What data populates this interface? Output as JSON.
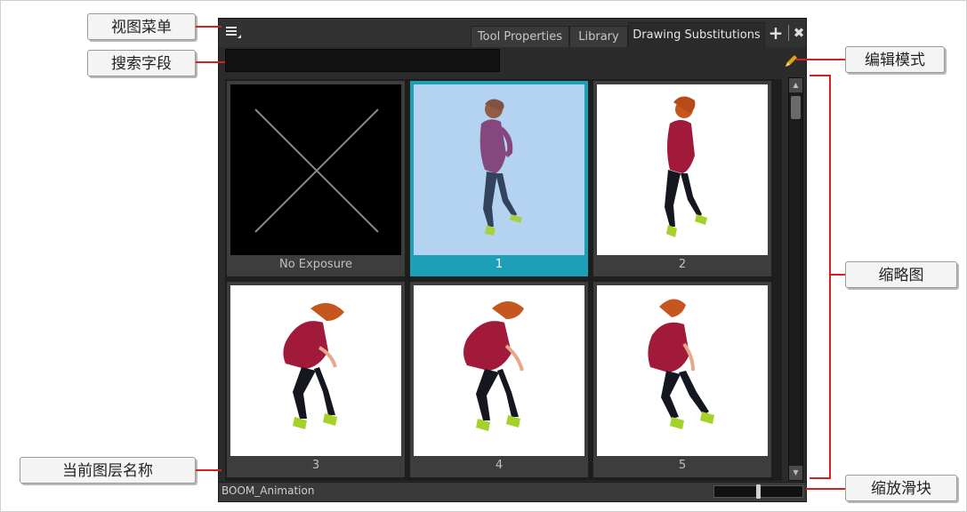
{
  "tabs": [
    {
      "label": "Tool Properties",
      "active": false
    },
    {
      "label": "Library",
      "active": false
    },
    {
      "label": "Drawing Substitutions",
      "active": true
    }
  ],
  "tab_buttons": {
    "add": "+",
    "close": "✖"
  },
  "search": {
    "value": "",
    "placeholder": ""
  },
  "thumbnails": [
    {
      "label": "No Exposure",
      "type": "no-exposure"
    },
    {
      "label": "1",
      "type": "drawing",
      "selected": true
    },
    {
      "label": "2",
      "type": "drawing"
    },
    {
      "label": "3",
      "type": "drawing"
    },
    {
      "label": "4",
      "type": "drawing"
    },
    {
      "label": "5",
      "type": "drawing"
    }
  ],
  "status": {
    "layer_name": "BOOM_Animation"
  },
  "zoom": {
    "level": 0.5
  },
  "callouts": {
    "view_menu": "视图菜单",
    "search_field": "搜索字段",
    "edit_mode": "编辑模式",
    "thumbnails": "缩略图",
    "current_layer_name": "当前图层名称",
    "zoom_slider": "缩放滑块"
  },
  "colors": {
    "callout_line": "#d6201f",
    "selection": "#1e9fb8",
    "selected_thumb_bg": "#b3d3f1",
    "edit_pencil": "#e3a21a"
  },
  "icons": {
    "menu": "menu-icon",
    "edit": "pencil-icon",
    "add": "plus-icon",
    "close": "close-icon"
  }
}
